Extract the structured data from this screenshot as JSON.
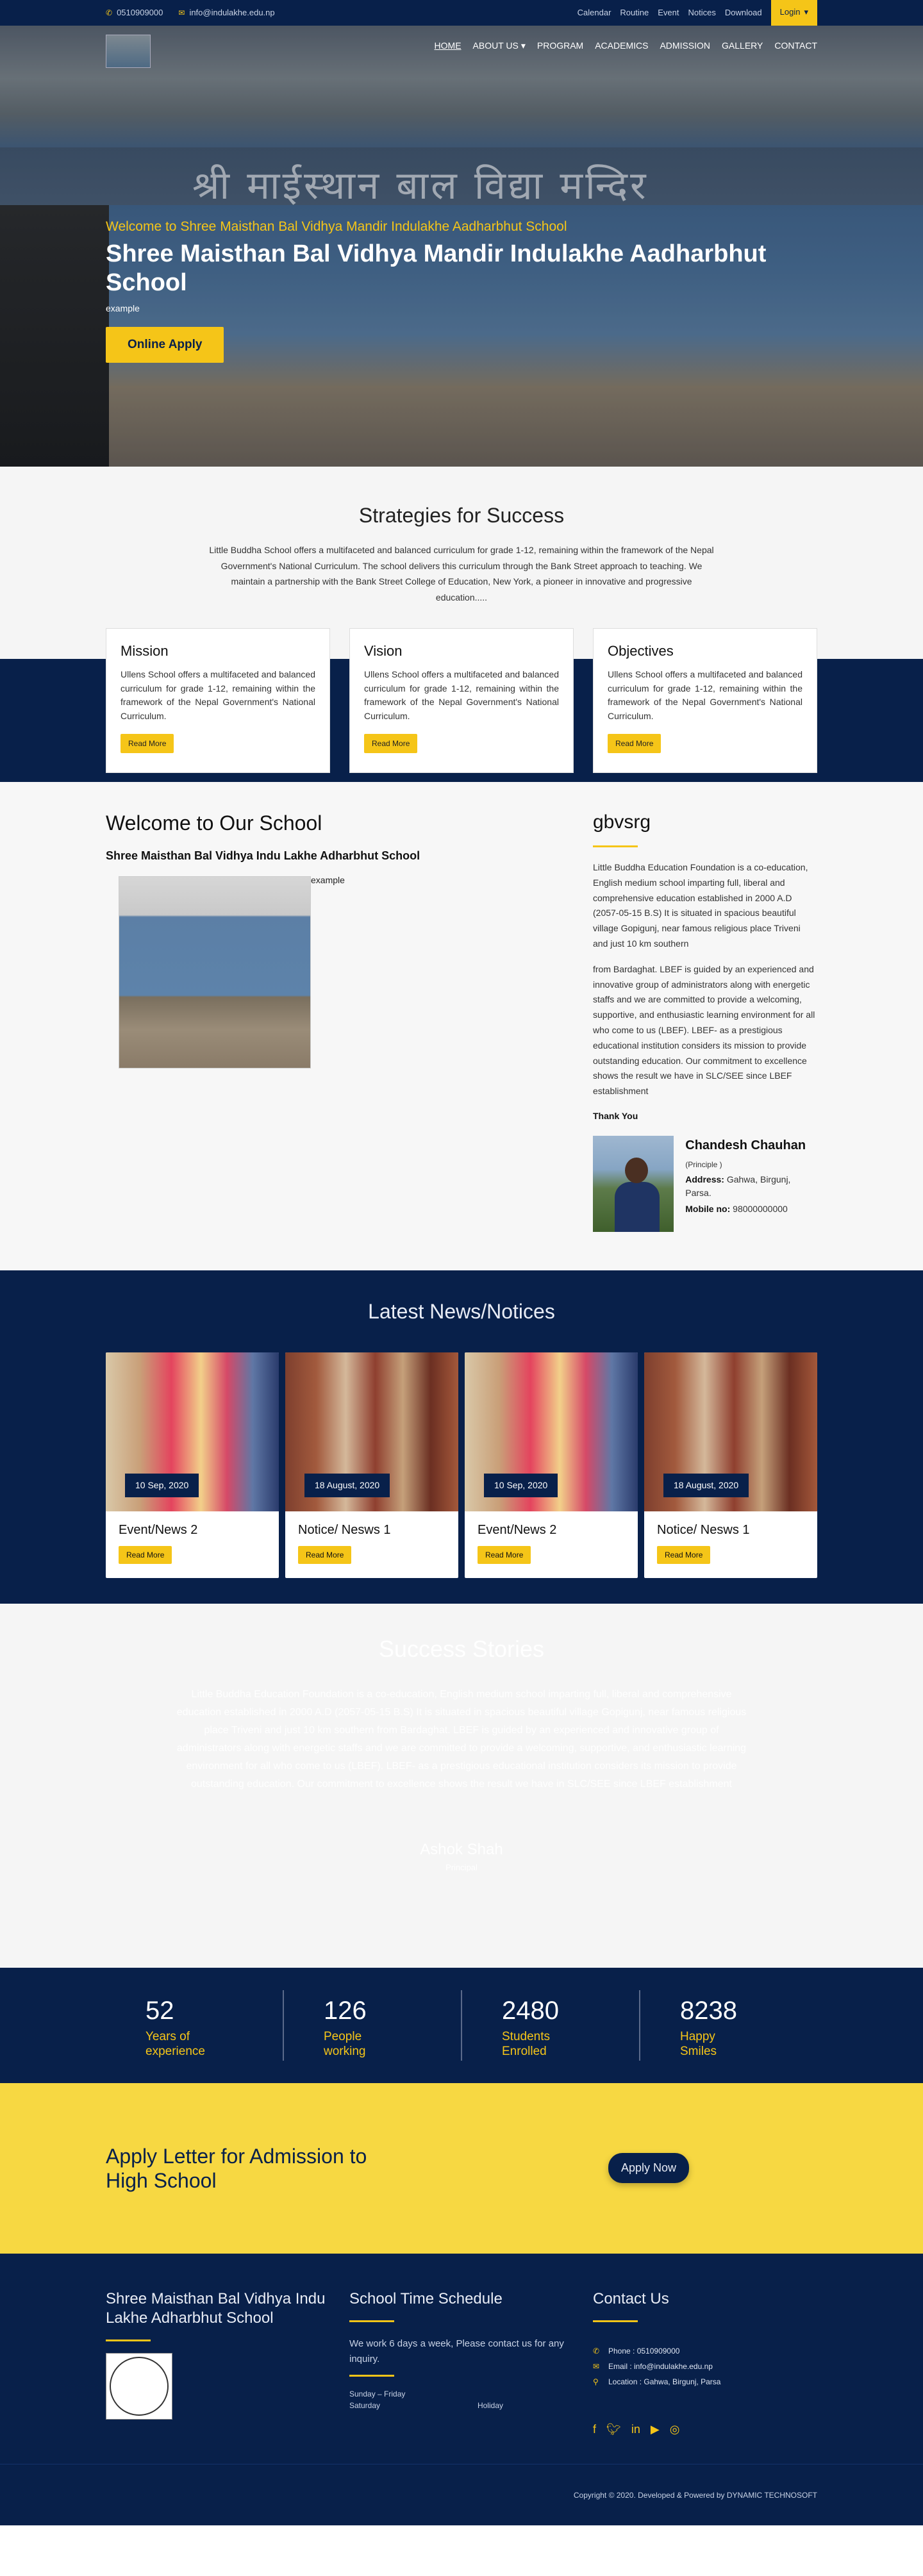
{
  "topbar": {
    "phone": "0510909000",
    "email": "info@indulakhe.edu.np",
    "links": [
      "Calendar",
      "Routine",
      "Event",
      "Notices",
      "Download"
    ],
    "login": "Login"
  },
  "nav": {
    "items": [
      "HOME",
      "ABOUT US",
      "PROGRAM",
      "ACADEMICS",
      "ADMISSION",
      "GALLERY",
      "CONTACT"
    ],
    "wall_text": "श्री माईस्थान बाल विद्या मन्दिर"
  },
  "hero": {
    "subtitle": "Welcome to Shree Maisthan Bal Vidhya Mandir Indulakhe Aadharbhut School",
    "title": "Shree Maisthan Bal Vidhya Mandir Indulakhe Aadharbhut School",
    "example": "example",
    "apply": "Online Apply"
  },
  "strategies": {
    "title": "Strategies for Success",
    "text": "Little Buddha School offers a multifaceted and balanced curriculum for grade 1-12, remaining within the framework of the Nepal Government's National Curriculum. The school delivers this curriculum through the Bank Street approach to teaching. We maintain a partnership with the Bank Street College of Education, New York, a pioneer in innovative and progressive education.....",
    "cards": [
      {
        "title": "Mission",
        "text": "Ullens School offers a multifaceted and balanced curriculum for grade 1-12, remaining within the framework of the Nepal Government's National Curriculum.",
        "button": "Read More"
      },
      {
        "title": "Vision",
        "text": "Ullens School offers a multifaceted and balanced curriculum for grade 1-12, remaining within the framework of the Nepal Government's National Curriculum.",
        "button": "Read More"
      },
      {
        "title": "Objectives",
        "text": "Ullens School offers a multifaceted and balanced curriculum for grade 1-12, remaining within the framework of the Nepal Government's National Curriculum.",
        "button": "Read More"
      }
    ]
  },
  "welcome": {
    "title": "Welcome to Our School",
    "subtitle": "Shree Maisthan Bal Vidhya Indu Lakhe Adharbhut School",
    "img_caption": "example",
    "side_title": "gbvsrg",
    "p1": "Little Buddha Education Foundation is a co-education, English medium school imparting full, liberal and comprehensive education established in 2000 A.D (2057-05-15 B.S) It is situated in spacious beautiful village Gopigunj, near famous religious place Triveni and just 10 km southern",
    "p2": "from Bardaghat. LBEF is guided by an experienced and innovative group of administrators along with energetic staffs and we are committed to provide a welcoming, supportive, and enthusiastic learning environment for all who come to us (LBEF). LBEF- as a prestigious educational institution considers its mission to provide outstanding education. Our commitment to excellence shows the result we have in SLC/SEE since LBEF establishment",
    "thanks": "Thank You",
    "principal": {
      "name": "Chandesh Chauhan",
      "role": "(Principle )",
      "address_label": "Address:",
      "address": "Gahwa, Birgunj, Parsa.",
      "mobile_label": "Mobile no:",
      "mobile": "98000000000"
    }
  },
  "news": {
    "title": "Latest News/Notices",
    "items": [
      {
        "date": "10 Sep, 2020",
        "title": "Event/News 2",
        "button": "Read More"
      },
      {
        "date": "18 August, 2020",
        "title": "Notice/ Nesws 1",
        "button": "Read More"
      },
      {
        "date": "10 Sep, 2020",
        "title": "Event/News 2",
        "button": "Read More"
      },
      {
        "date": "18 August, 2020",
        "title": "Notice/ Nesws 1",
        "button": "Read More"
      }
    ]
  },
  "success": {
    "title": "Success Stories",
    "text": "Little Buddha Education Foundation is a co-education, English medium school imparting full, liberal and comprehensive education established in 2000 A.D (2057-05-15 B.S) It is situated in spacious beautiful village Gopigunj, near famous religious place Triveni and just 10 km southern from Bardaghat. LBEF is guided by an experienced and innovative group of administrators along with energetic staffs and we are committed to provide a welcoming, supportive, and enthusiastic learning environment for all who come to us (LBEF). LBEF- as a prestigious educational institution considers its mission to provide outstanding education. Our commitment to excellence shows the result we have in SLC/SEE since LBEF establishment",
    "name": "Ashok Shah",
    "position": "Principal"
  },
  "stats": [
    {
      "num": "52",
      "l1": "Years of",
      "l2": "experience"
    },
    {
      "num": "126",
      "l1": "People",
      "l2": "working"
    },
    {
      "num": "2480",
      "l1": "Students",
      "l2": "Enrolled"
    },
    {
      "num": "8238",
      "l1": "Happy",
      "l2": "Smiles"
    }
  ],
  "apply": {
    "title": "Apply Letter for Admission to High School",
    "button": "Apply Now"
  },
  "footer": {
    "school": "Shree Maisthan Bal Vidhya Indu Lakhe Adharbhut School",
    "schedule_title": "School Time Schedule",
    "schedule_text": "We work 6 days a week, Please contact us for any inquiry.",
    "days": "Sunday – Friday",
    "sat": "Saturday",
    "holiday": "Holiday",
    "contact_title": "Contact Us",
    "phone": "Phone : 0510909000",
    "email": "Email : info@indulakhe.edu.np",
    "location": "Location : Gahwa, Birgunj, Parsa",
    "copyright": "Copyright © 2020. Developed & Powered by DYNAMIC TECHNOSOFT"
  },
  "colors": {
    "navy": "#08204a",
    "accent": "#f5c518",
    "apply_band": "#f7d842"
  },
  "icons": [
    "phone-icon",
    "email-icon",
    "location-icon",
    "facebook-icon",
    "twitter-icon",
    "linkedin-icon",
    "youtube-icon",
    "instagram-icon"
  ]
}
